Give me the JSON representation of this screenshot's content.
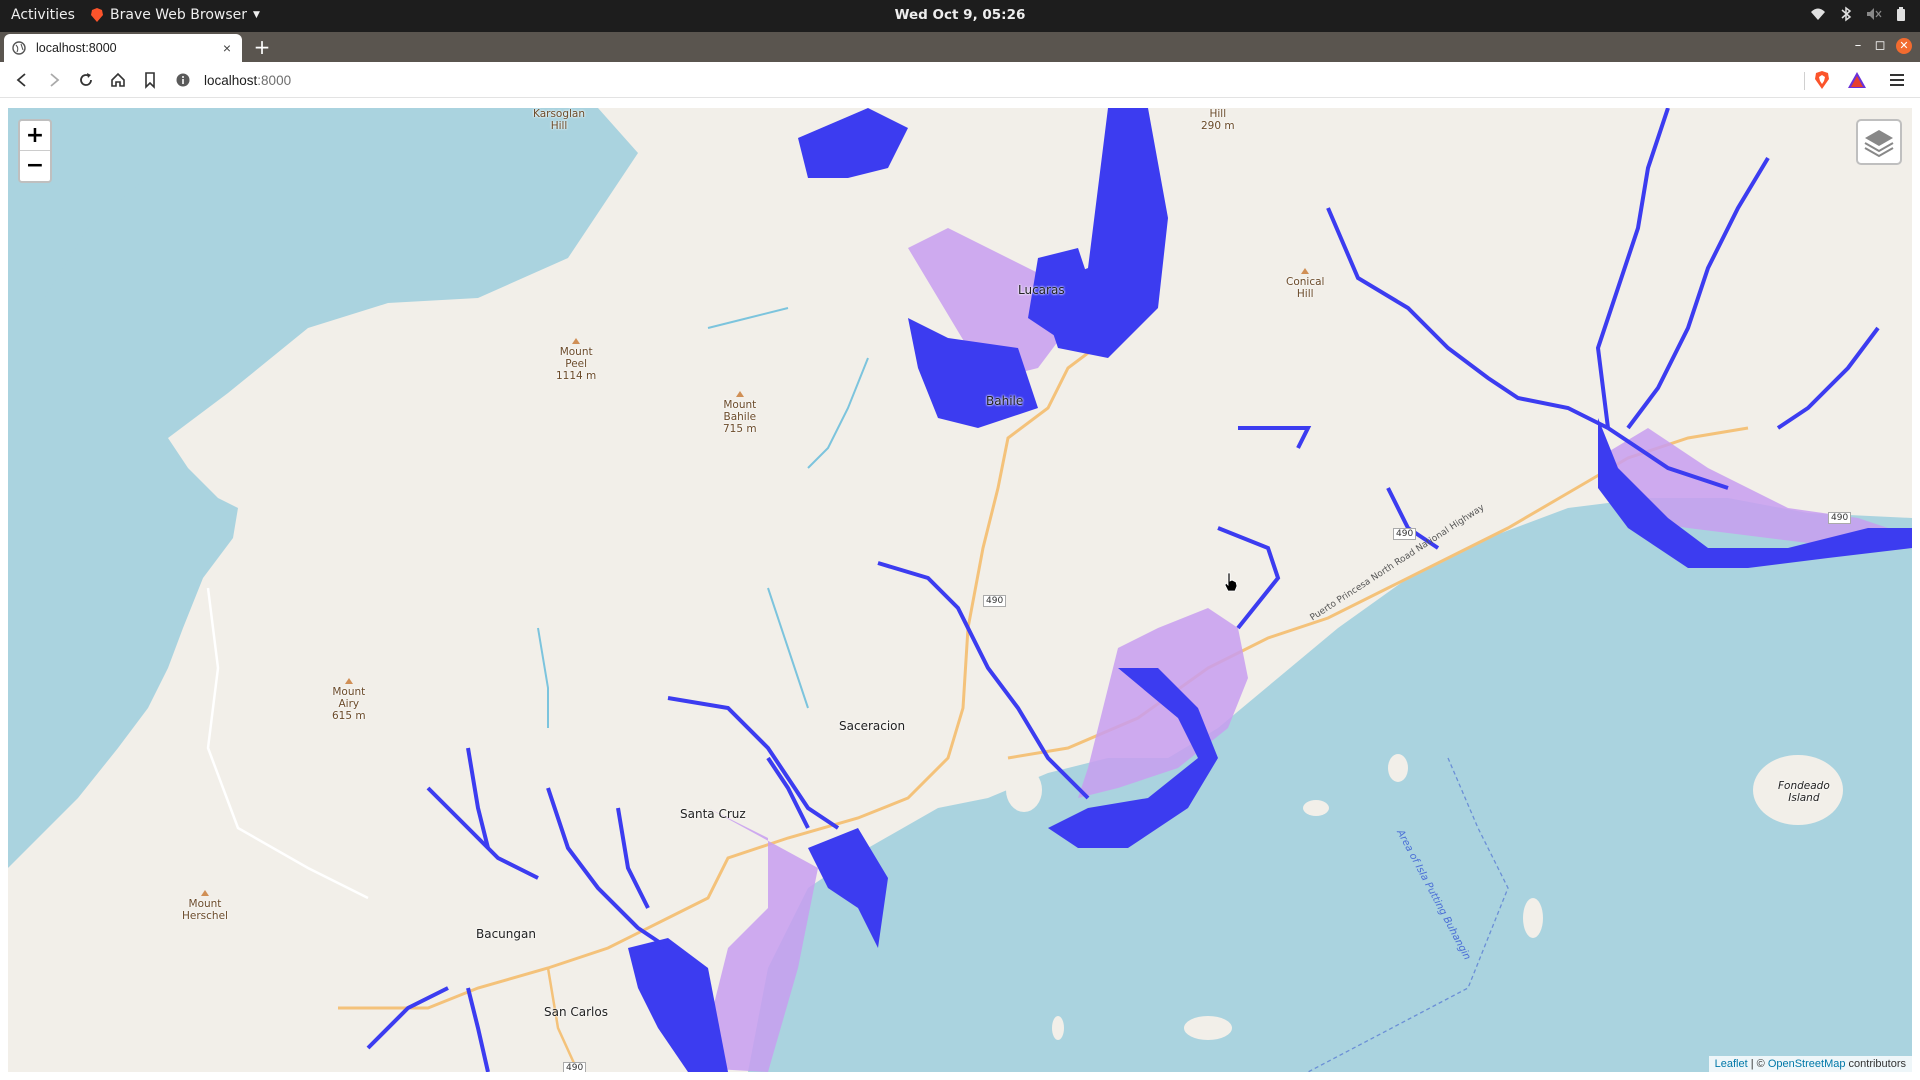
{
  "system_bar": {
    "activities": "Activities",
    "app_name": "Brave Web Browser",
    "clock": "Wed Oct  9, 05:26",
    "tray_icons": [
      "wifi-icon",
      "bluetooth-icon",
      "volume-icon",
      "battery-icon"
    ]
  },
  "browser": {
    "tab_title": "localhost:8000",
    "url_host": "localhost",
    "url_port": ":8000",
    "new_tab_label": "+",
    "close_tab_label": "×"
  },
  "map": {
    "zoom_in": "+",
    "zoom_out": "−",
    "attribution": {
      "leaflet": "Leaflet",
      "separator": " | © ",
      "osm": "OpenStreetMap",
      "contributors": " contributors"
    },
    "places": {
      "karsoglan": [
        "Karsoglan",
        "Hill"
      ],
      "hill_top": [
        "Hill",
        "290 m"
      ],
      "conical": [
        "Conical",
        "Hill"
      ],
      "bahile": "Bahile",
      "lucarase": "Lucaras",
      "mount_peel": [
        "Mount",
        "Peel",
        "1114 m"
      ],
      "mount_bahile": [
        "Mount",
        "Bahile",
        "715 m"
      ],
      "mount_airy": [
        "Mount",
        "Airy",
        "615 m"
      ],
      "mount_herschel": [
        "Mount",
        "Herschel"
      ],
      "saceracion": "Saceracion",
      "santa_cruz": "Santa Cruz",
      "bacungan": "Bacungan",
      "san_carlos": "San Carlos",
      "fondeado": [
        "Fondeado",
        "Island"
      ],
      "water_area": "Area of Isla Putting Buhangin",
      "highway": "Puerto Princesa North Road National Highway",
      "road_490": "490"
    },
    "colors": {
      "sea": "#aad3df",
      "land": "#f2efe9",
      "flood_deep": "#3c3cf0",
      "flood_light": "#c89ef0",
      "road": "#f4c27a"
    }
  }
}
